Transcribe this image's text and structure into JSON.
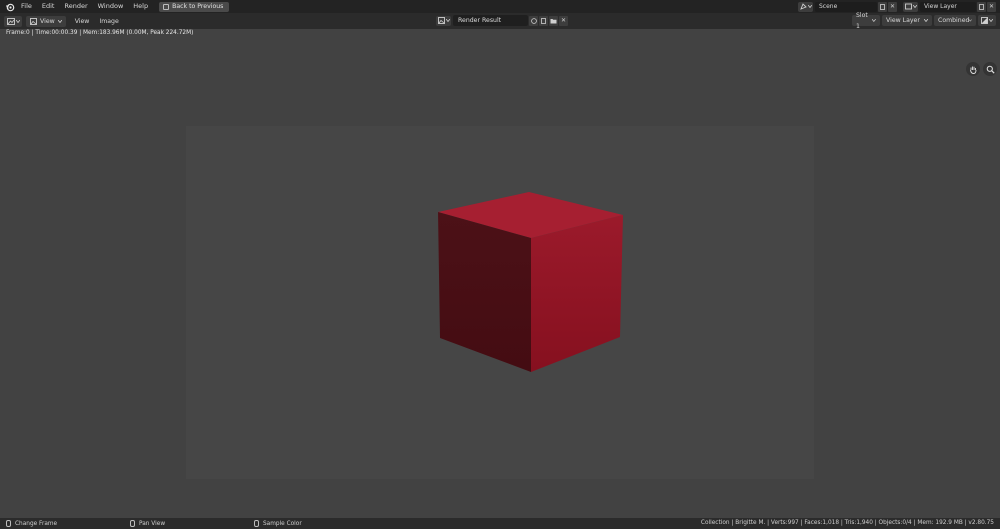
{
  "topbar": {
    "menu": [
      "File",
      "Edit",
      "Render",
      "Window",
      "Help"
    ],
    "back_button": "Back to Previous",
    "scene": "Scene",
    "view_layer": "View Layer"
  },
  "editor_header": {
    "mode": "View",
    "menus": [
      "View",
      "Image"
    ],
    "image_name": "Render Result",
    "slot": "Slot 1",
    "layer": "View Layer",
    "pass": "Combined"
  },
  "info_line": "Frame:0 | Time:00:00.39 | Mem:183.96M (0.00M, Peak 224.72M)",
  "statusbar": {
    "left": "Change Frame",
    "middle": "Pan View",
    "right": "Sample Color",
    "stats": "Collection | Brigitte M. | Verts:997 | Faces:1,018 | Tris:1,940 | Objects:0/4 | Mem: 192.9 MB | v2.80.75"
  },
  "icons": [
    "blender-logo-icon",
    "image-editor-icon",
    "hand-icon",
    "zoom-icon"
  ],
  "colors": {
    "cube_top": "#a61f31",
    "cube_left": "#4a0f15",
    "cube_right": "#8e1224",
    "viewport_bg": "#424242",
    "image_bg": "#464646"
  }
}
